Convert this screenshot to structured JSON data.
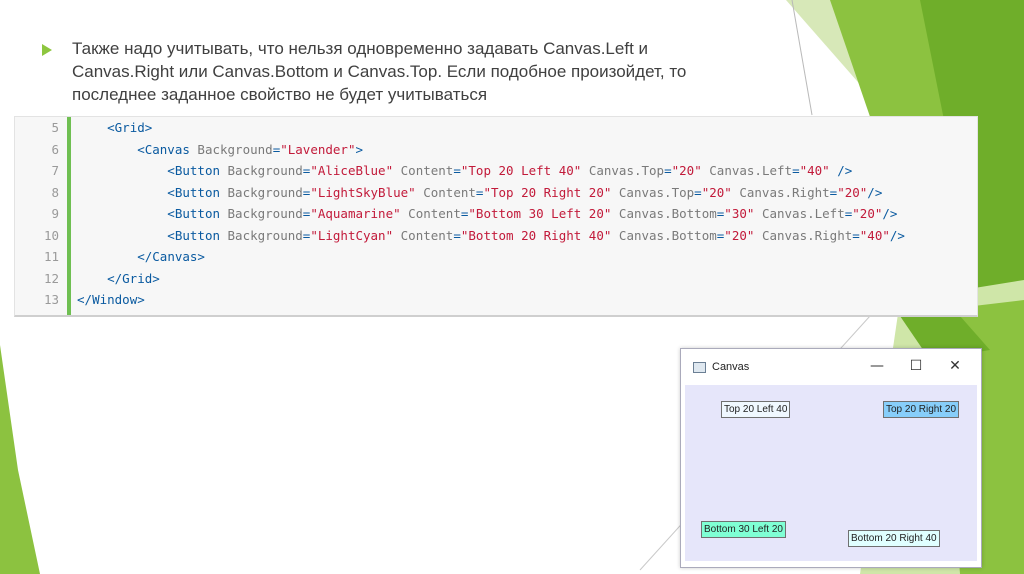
{
  "slide": {
    "bullet_text": "Также надо учитывать, что нельзя одновременно задавать Canvas.Left и\nCanvas.Right или Canvas.Bottom и Canvas.Top. Если подобное произойдет, то\nпоследнее заданное свойство не будет учитываться"
  },
  "code": {
    "lines": [
      {
        "num": "5",
        "text": "    <Grid>"
      },
      {
        "num": "6",
        "text": "        <Canvas Background=\"Lavender\">"
      },
      {
        "num": "7",
        "text": "            <Button Background=\"AliceBlue\" Content=\"Top 20 Left 40\" Canvas.Top=\"20\" Canvas.Left=\"40\" />"
      },
      {
        "num": "8",
        "text": "            <Button Background=\"LightSkyBlue\" Content=\"Top 20 Right 20\" Canvas.Top=\"20\" Canvas.Right=\"20\"/>"
      },
      {
        "num": "9",
        "text": "            <Button Background=\"Aquamarine\" Content=\"Bottom 30 Left 20\" Canvas.Bottom=\"30\" Canvas.Left=\"20\"/>"
      },
      {
        "num": "10",
        "text": "            <Button Background=\"LightCyan\" Content=\"Bottom 20 Right 40\" Canvas.Bottom=\"20\" Canvas.Right=\"40\"/>"
      },
      {
        "num": "11",
        "text": "        </Canvas>"
      },
      {
        "num": "12",
        "text": "    </Grid>"
      },
      {
        "num": "13",
        "text": "</Window>"
      }
    ]
  },
  "window": {
    "title": "Canvas",
    "minimize_glyph": "—",
    "maximize_glyph": "☐",
    "close_glyph": "✕",
    "buttons": [
      {
        "label": "Top 20 Left 40",
        "bg": "#f0f8ff"
      },
      {
        "label": "Top 20 Right 20",
        "bg": "#87cefa"
      },
      {
        "label": "Bottom 30 Left 20",
        "bg": "#7fffd4"
      },
      {
        "label": "Bottom 20 Right 40",
        "bg": "#e0ffff"
      }
    ]
  },
  "colors": {
    "accent_green": "#8dc63f",
    "code_bar": "#6fbf52",
    "canvas_bg": "#e6e6fa"
  }
}
